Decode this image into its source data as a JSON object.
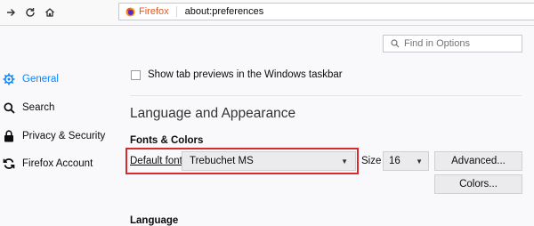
{
  "browser": {
    "identity_label": "Firefox",
    "url": "about:preferences"
  },
  "search": {
    "placeholder": "Find in Options"
  },
  "sidebar": {
    "items": [
      {
        "label": "General",
        "icon": "gear-icon",
        "selected": true
      },
      {
        "label": "Search",
        "icon": "search-icon",
        "selected": false
      },
      {
        "label": "Privacy & Security",
        "icon": "lock-icon",
        "selected": false
      },
      {
        "label": "Firefox Account",
        "icon": "sync-icon",
        "selected": false
      }
    ]
  },
  "main": {
    "taskbar_checkbox": {
      "label": "Show tab previews in the Windows taskbar",
      "checked": false
    },
    "section_title": "Language and Appearance",
    "fonts_colors": {
      "heading": "Fonts & Colors",
      "default_font_label": "Default font",
      "default_font_value": "Trebuchet MS",
      "size_label": "Size",
      "size_value": "16",
      "advanced_button": "Advanced...",
      "colors_button": "Colors..."
    },
    "language_heading": "Language"
  },
  "colors": {
    "accent": "#0a84ff",
    "highlight_box": "#d92b2b",
    "firefox_label": "#e25920"
  }
}
